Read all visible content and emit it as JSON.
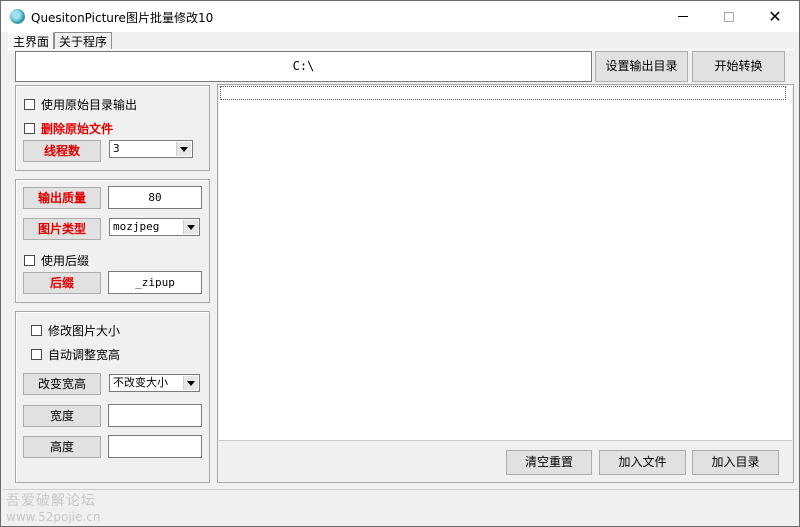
{
  "window": {
    "title": "QuesitonPicture图片批量修改10",
    "icon": "app-logo-icon"
  },
  "tabs": [
    {
      "label": "主界面",
      "active": true
    },
    {
      "label": "关于程序",
      "active": false
    }
  ],
  "toolbar": {
    "output_path": "C:\\",
    "set_output_dir_label": "设置输出目录",
    "start_convert_label": "开始转换"
  },
  "group1": {
    "use_source_dir_label": "使用原始目录输出",
    "delete_source_label": "删除原始文件",
    "threads_label": "线程数",
    "threads_value": "3"
  },
  "group2": {
    "quality_label": "输出质量",
    "quality_value": "80",
    "type_label": "图片类型",
    "type_value": "mozjpeg",
    "use_suffix_label": "使用后缀",
    "suffix_label": "后缀",
    "suffix_value": "_zipup"
  },
  "group3": {
    "resize_label": "修改图片大小",
    "auto_adjust_label": "自动调整宽高",
    "change_size_label": "改变宽高",
    "change_size_value": "不改变大小",
    "width_label": "宽度",
    "width_value": "",
    "height_label": "高度",
    "height_value": ""
  },
  "file_actions": {
    "clear_label": "清空重置",
    "add_files_label": "加入文件",
    "add_dir_label": "加入目录"
  },
  "watermark": {
    "line1": "吾爱破解论坛",
    "line2": "www.52pojie.cn"
  },
  "colors": {
    "accent_red": "#e00000"
  }
}
